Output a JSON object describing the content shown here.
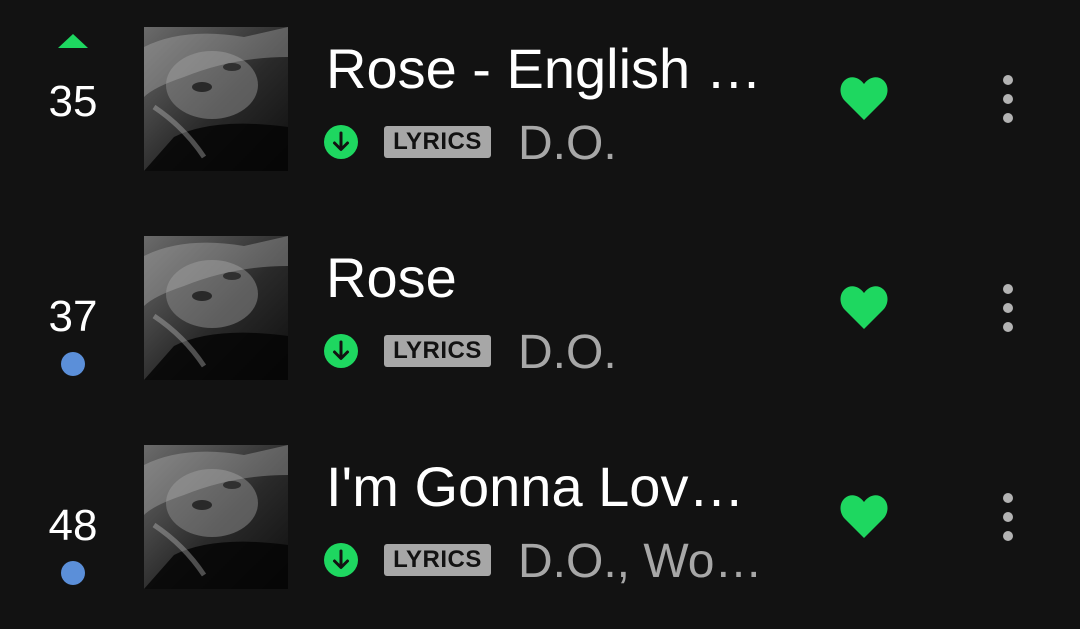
{
  "colors": {
    "background": "#121212",
    "accent_green": "#1ed760",
    "secondary_text": "#a7a7a7",
    "new_dot_blue": "#5b8fd9"
  },
  "tracks": [
    {
      "rank": "35",
      "trend": "up",
      "trend_icon": "triangle-up-icon",
      "title": "Rose - English …",
      "badge": "LYRICS",
      "artist": "D.O.",
      "downloaded": true,
      "liked": true
    },
    {
      "rank": "37",
      "trend": "new",
      "trend_icon": "blue-dot-icon",
      "title": "Rose",
      "badge": "LYRICS",
      "artist": "D.O.",
      "downloaded": true,
      "liked": true
    },
    {
      "rank": "48",
      "trend": "new",
      "trend_icon": "blue-dot-icon",
      "title": "I'm Gonna Lov…",
      "badge": "LYRICS",
      "artist": "D.O., Wo…",
      "downloaded": true,
      "liked": true
    }
  ]
}
